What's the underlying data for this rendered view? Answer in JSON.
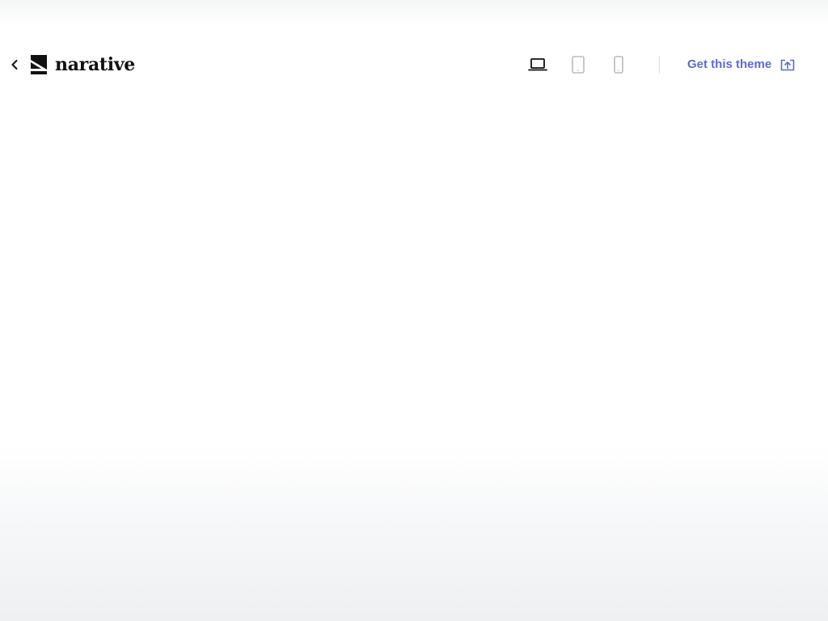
{
  "header": {
    "back_icon": "chevron-left-icon",
    "logo": {
      "mark_icon": "narative-logo-mark",
      "text": "narative"
    },
    "devices": [
      {
        "name": "desktop",
        "icon": "laptop-icon",
        "active": true
      },
      {
        "name": "tablet",
        "icon": "tablet-icon",
        "active": false
      },
      {
        "name": "mobile",
        "icon": "mobile-icon",
        "active": false
      }
    ],
    "get_theme_label": "Get this theme",
    "open_icon": "open-external-icon"
  },
  "colors": {
    "accent": "#5b6ad3",
    "text": "#111111",
    "inactive_icon": "#b8bbc2",
    "divider": "#dcdde0"
  }
}
